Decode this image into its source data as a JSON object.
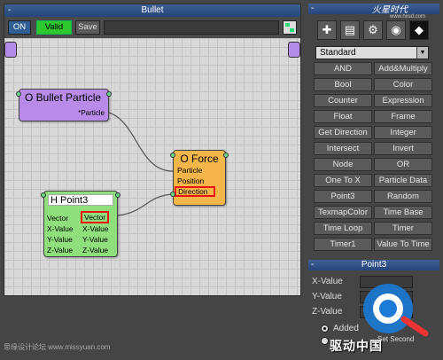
{
  "editor": {
    "title": "Bullet",
    "minimize": "-",
    "toolbar": {
      "on_label": "ON",
      "valid_label": "Valid",
      "save_label": "Save"
    },
    "nodes": {
      "particle": {
        "title": "O Bullet Particle",
        "output": "*Particle"
      },
      "force": {
        "title": "O Force",
        "inputs": [
          "Particle",
          "Position",
          "Direction"
        ]
      },
      "point3": {
        "title": "H Point3",
        "rows": [
          {
            "left": "Vector",
            "right": "Vector"
          },
          {
            "left": "X-Value",
            "right": "X-Value"
          },
          {
            "left": "Y-Value",
            "right": "Y-Value"
          },
          {
            "left": "Z-Value",
            "right": "Z-Value"
          }
        ]
      }
    }
  },
  "panel": {
    "minimize": "-",
    "category": "Standard",
    "operators": [
      [
        "AND",
        "Add&Multiply"
      ],
      [
        "Bool",
        "Color"
      ],
      [
        "Counter",
        "Expression"
      ],
      [
        "Float",
        "Frame"
      ],
      [
        "Get Direction",
        "Integer"
      ],
      [
        "Intersect",
        "Invert"
      ],
      [
        "Node",
        "OR"
      ],
      [
        "One To X",
        "Particle Data"
      ],
      [
        "Point3",
        "Random"
      ],
      [
        "TexmapColor",
        "Time Base"
      ],
      [
        "Time Loop",
        "Timer"
      ],
      [
        "Timer1",
        "Value To Time"
      ]
    ],
    "props_title": "Point3",
    "props": [
      "X-Value",
      "Y-Value",
      "Z-Value"
    ],
    "radio_added": "Added",
    "radio_second": "Set Second"
  },
  "watermark": {
    "footer_left": "思缘设计论坛 www.missyuan.com",
    "brand_top": "火星时代",
    "brand_url": "www.hxsd.com",
    "brand_bottom": "驱动中国"
  }
}
